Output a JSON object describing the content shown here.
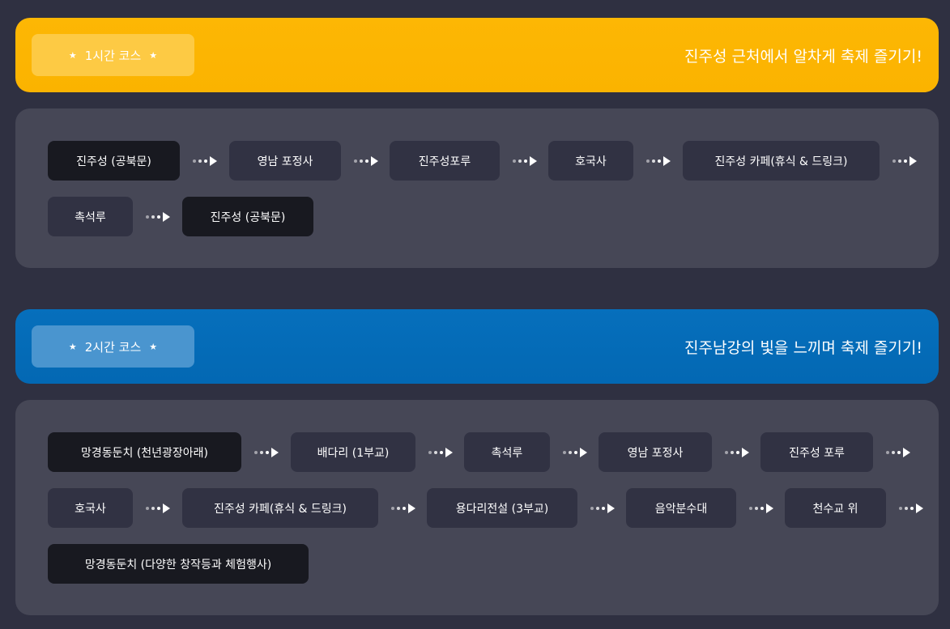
{
  "course1": {
    "badge": "1시간 코스",
    "headline": "진주성 근처에서 알차게 축제 즐기기!",
    "stops": [
      "진주성 (공북문)",
      "영남 포정사",
      "진주성포루",
      "호국사",
      "진주성 카페(휴식 & 드링크)",
      "촉석루",
      "진주성 (공북문)"
    ]
  },
  "course2": {
    "badge": "2시간 코스",
    "headline": "진주남강의 빛을 느끼며 축제 즐기기!",
    "stops": [
      "망경동둔치 (천년광장아래)",
      "배다리 (1부교)",
      "촉석루",
      "영남 포정사",
      "진주성 포루",
      "호국사",
      "진주성 카페(휴식 & 드링크)",
      "용다리전설 (3부교)",
      "음악분수대",
      "천수교 위",
      "망경동둔치 (다양한 창작등과 체험행사)"
    ]
  },
  "icons": {
    "badge_icon": "star-icon",
    "route_arrow": "dotted-arrow-icon"
  },
  "colors": {
    "course1_accent": "#fdb704",
    "course2_accent": "#066fbc",
    "panel": "#464756",
    "stop": "#313243",
    "stop_endpoint": "#181920"
  }
}
